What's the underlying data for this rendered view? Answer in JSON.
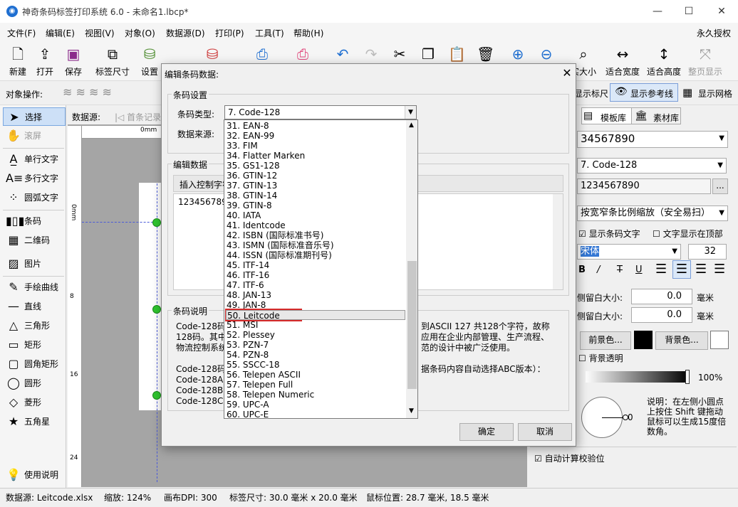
{
  "window": {
    "title": "神奇条码标签打印系统 6.0 - 未命名1.lbcp*",
    "minimize": "—",
    "maximize": "☐",
    "close": "✕"
  },
  "menu": [
    "文件(F)",
    "编辑(E)",
    "视图(V)",
    "对象(O)",
    "数据源(D)",
    "打印(P)",
    "工具(T)",
    "帮助(H)"
  ],
  "menu_right": "永久授权",
  "toolbar": {
    "new": "新建",
    "open": "打开",
    "save": "保存",
    "label_size": "标签尺寸",
    "settings": "设置",
    "actual_size": "实大小",
    "fit_width": "适合宽度",
    "fit_height": "适合高度",
    "full_page": "整页显示"
  },
  "opsbar": {
    "label": "对象操作:",
    "show_ruler": "显示标尺",
    "show_guides": "显示参考线",
    "show_grid": "显示网格"
  },
  "left_panel": {
    "select": "选择",
    "scroll": "滚屏",
    "single_text": "单行文字",
    "multi_text": "多行文字",
    "arc_text": "圆弧文字",
    "barcode": "条码",
    "qrcode": "二维码",
    "image": "图片",
    "freehand": "手绘曲线",
    "line": "直线",
    "triangle": "三角形",
    "rect": "矩形",
    "round_rect": "圆角矩形",
    "circle": "圆形",
    "diamond": "菱形",
    "star": "五角星",
    "help": "使用说明"
  },
  "datasource_bar": {
    "label": "数据源:",
    "first": "首条记录"
  },
  "ruler": {
    "unit": "0mm",
    "v_ticks": [
      "0mm",
      "8",
      "16",
      "24"
    ]
  },
  "right_panel": {
    "tab_templates": "模板库",
    "tab_assets": "素材库",
    "barcode_value": "34567890",
    "barcode_type": "7. Code-128",
    "data_value": "1234567890",
    "scale_mode": "按宽窄条比例缩放（安全易扫）",
    "show_text": "显示条码文字",
    "text_top": "文字显示在顶部",
    "font": "宋体",
    "font_size": "32",
    "left_margin_label": "侧留白大小:",
    "left_margin_value": "0.0",
    "right_margin_label": "侧留白大小:",
    "right_margin_value": "0.0",
    "unit": "毫米",
    "fg_color": "前景色...",
    "bg_color": "背景色...",
    "bg_transparent": "背景透明",
    "opacity": "100%",
    "rotation_value": "0",
    "rotation_tip": "说明：在左侧小圆点上按住 Shift 键拖动鼠标可以生成15度倍数角。",
    "auto_check": "自动计算校验位"
  },
  "status": {
    "datasource": "数据源:  Leitcode.xlsx",
    "zoom": "缩放:  124%",
    "dpi": "画布DPI:  300",
    "label_size": "标签尺寸:  30.0 毫米 x 20.0 毫米",
    "mouse": "鼠标位置:  28.7 毫米,  18.5 毫米"
  },
  "dialog": {
    "title": "编辑条码数据:",
    "close": "✕",
    "group_settings": "条码设置",
    "type_label": "条码类型:",
    "type_value": "7.  Code-128",
    "source_label": "数据来源:",
    "group_edit": "编辑数据",
    "insert_ctrl": "插入控制字符",
    "data_value": "123456789",
    "group_desc": "条码说明",
    "desc_left": [
      "Code-128码",
      "128码。其中",
      "物流控制系统",
      "",
      "Code-128码",
      "Code-128A:",
      "Code-128B:",
      "Code-128C:"
    ],
    "desc_right": [
      "到ASCII 127 共128个字符，故称",
      "应用在企业内部管理、生产流程、",
      "范的设计中被广泛使用。",
      "",
      "据条码内容自动选择ABC版本）："
    ],
    "ok": "确定",
    "cancel": "取消"
  },
  "dropdown": [
    "31.  EAN-8",
    "32.  EAN-99",
    "33.  FIM",
    "34.  Flatter Marken",
    "35.  GS1-128",
    "36.  GTIN-12",
    "37.  GTIN-13",
    "38.  GTIN-14",
    "39.  GTIN-8",
    "40.  IATA",
    "41.  Identcode",
    "42.  ISBN (国际标准书号)",
    "43.  ISMN (国际标准音乐号)",
    "44.  ISSN (国际标准期刊号)",
    "45.  ITF-14",
    "46.  ITF-16",
    "47.  ITF-6",
    "48.  JAN-13",
    "49.  JAN-8",
    "50.  Leitcode",
    "51.  MSI",
    "52.  Plessey",
    "53.  PZN-7",
    "54.  PZN-8",
    "55.  SSCC-18",
    "56.  Telepen ASCII",
    "57.  Telepen Full",
    "58.  Telepen Numeric",
    "59.  UPC-A",
    "60.  UPC-E"
  ],
  "dropdown_selected_index": 19,
  "colors": {
    "highlight_border": "#d62b2b",
    "handle": "#2fc52f",
    "accent": "#1f6fd1"
  }
}
